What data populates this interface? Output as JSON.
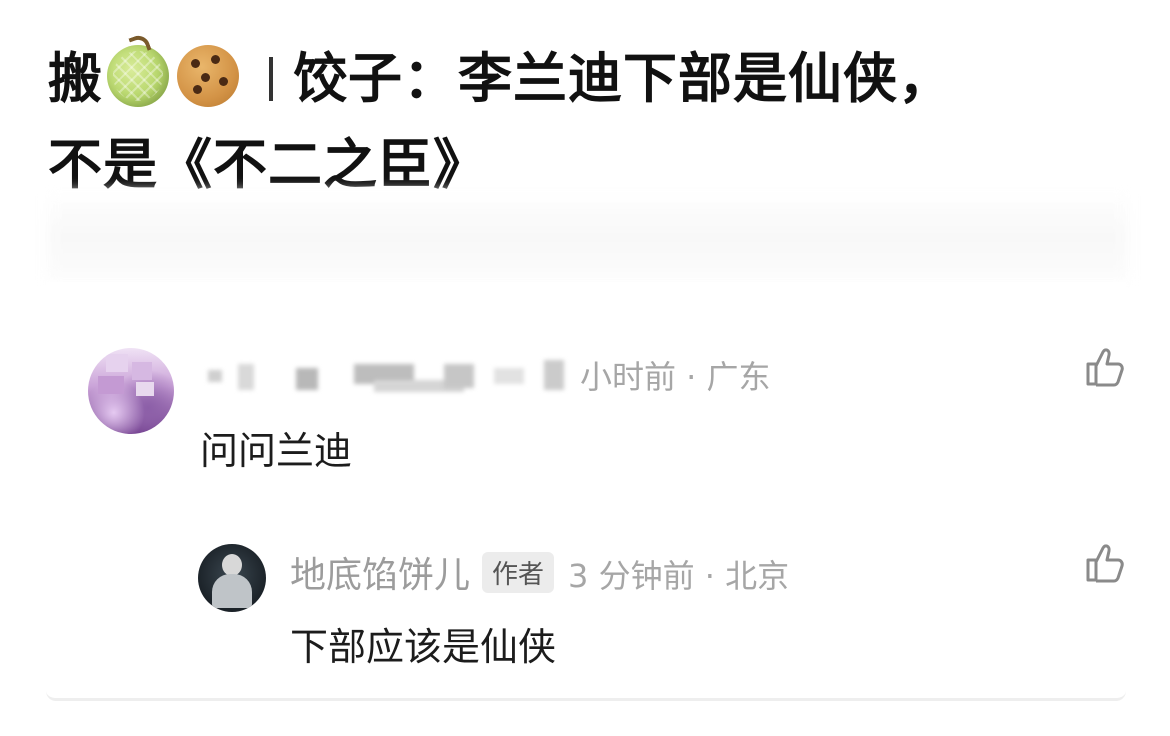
{
  "post": {
    "title_prefix": "搬",
    "title_line1": "饺子：李兰迪下部是仙侠，",
    "title_line2": "不是《不二之臣》",
    "emojis": [
      "melon-icon",
      "cookie-icon"
    ]
  },
  "comments": [
    {
      "time_location": "小时前 · 广东",
      "text": "问问兰迪",
      "like_icon": "thumbs-up-icon"
    }
  ],
  "reply": {
    "author": "地底馅饼儿",
    "badge": "作者",
    "time_location": "3 分钟前 · 北京",
    "text": "下部应该是仙侠",
    "like_icon": "thumbs-up-icon"
  }
}
